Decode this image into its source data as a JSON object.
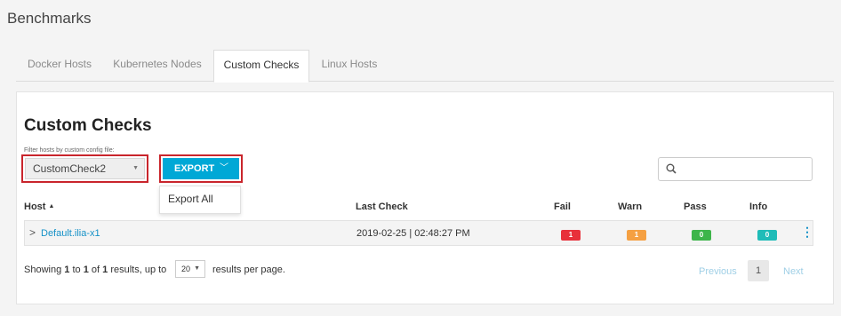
{
  "page": {
    "title": "Benchmarks"
  },
  "tabs": [
    {
      "label": "Docker Hosts",
      "active": false
    },
    {
      "label": "Kubernetes Nodes",
      "active": false
    },
    {
      "label": "Custom Checks",
      "active": true
    },
    {
      "label": "Linux Hosts",
      "active": false
    }
  ],
  "section": {
    "title": "Custom Checks",
    "filter_label": "Filter hosts by custom config file:",
    "filter_value": "CustomCheck2",
    "export_label": "EXPORT",
    "export_menu": [
      "Export All"
    ],
    "search_placeholder": ""
  },
  "table": {
    "columns": [
      "Host",
      "Last Check",
      "Fail",
      "Warn",
      "Pass",
      "Info"
    ],
    "sort_indicator": "▲",
    "rows": [
      {
        "host": "Default.ilia-x1",
        "last_check": "2019-02-25 | 02:48:27 PM",
        "fail": "1",
        "warn": "1",
        "pass": "0",
        "info": "0"
      }
    ]
  },
  "footer": {
    "showing": "Showing",
    "from": "1",
    "to_word": "to",
    "to": "1",
    "of_word": "of",
    "total": "1",
    "results_up_to": "results, up to",
    "per_page": "20",
    "per_page_suffix": "results per page."
  },
  "pagination": {
    "previous": "Previous",
    "current": "1",
    "next": "Next"
  },
  "colors": {
    "accent": "#00a8d6",
    "fail": "#e8303a",
    "warn": "#f5a042",
    "pass": "#3db54a",
    "info": "#1fbcb8",
    "highlight": "#c9252c"
  }
}
